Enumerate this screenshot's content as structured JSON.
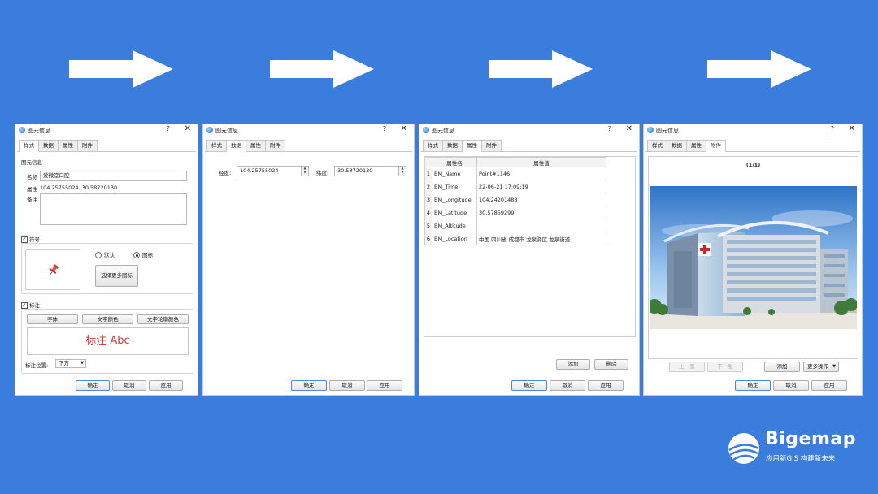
{
  "dialog_title": "图元信息",
  "help_glyph": "?",
  "close_glyph": "✕",
  "tabs": [
    "样式",
    "数据",
    "属性",
    "附件"
  ],
  "footer": {
    "ok": "确定",
    "cancel": "取消",
    "apply": "应用"
  },
  "style_panel": {
    "section_info": "图元信息",
    "name_label": "名称",
    "name_value": "爱微堂口腔",
    "attr_label": "属性",
    "attr_value": "104.25755024, 30.58720130",
    "note_label": "备注",
    "symbol_section": "符号",
    "radio_default": "默认",
    "radio_icon": "图标",
    "choose_icon_button": "选择更多图标",
    "label_section": "标注",
    "font_button": "字体",
    "text_color_button": "文字颜色",
    "outline_color_button": "文字轮廓颜色",
    "preview_text": "标注 Abc",
    "preview_color": "#d93a3a",
    "position_label": "标注位置:",
    "position_value": "下方"
  },
  "data_panel": {
    "lng_label": "经度:",
    "lng_value": "104.25755024",
    "lat_label": "纬度:",
    "lat_value": "30.58720130"
  },
  "attr_panel": {
    "col_name": "属性名",
    "col_value": "属性值",
    "rows": [
      {
        "n": "1",
        "name": "BM_Name",
        "value": "Point#1146"
      },
      {
        "n": "2",
        "name": "BM_Time",
        "value": "22-06-21 17:09:19"
      },
      {
        "n": "3",
        "name": "BM_Longitude",
        "value": "104.24201488"
      },
      {
        "n": "4",
        "name": "BM_Latitude",
        "value": "30.57859299"
      },
      {
        "n": "5",
        "name": "BM_Altitude",
        "value": ""
      },
      {
        "n": "6",
        "name": "BM_Location",
        "value": "中国 四川省 成都市 龙泉驿区 龙泉街道"
      }
    ],
    "add_button": "添加",
    "delete_button": "删除"
  },
  "attach_panel": {
    "counter": "(1/1)",
    "prev_button": "上一张",
    "next_button": "下一张",
    "add_button": "添加",
    "more_button": "更多操作",
    "image_subject": "hospital-building-photo"
  },
  "brand": {
    "name": "Bigemap",
    "slogan": "应用新GIS  构建新未来"
  },
  "colors": {
    "background": "#3b7ddd",
    "accent": "#4a8ad8"
  }
}
